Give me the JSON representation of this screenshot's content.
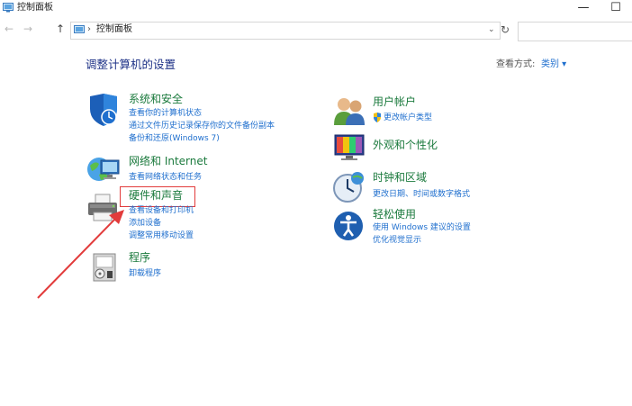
{
  "window": {
    "title": "控制面板",
    "minimize": "—",
    "maximize": "☐"
  },
  "address": {
    "back": "←",
    "forward": "→",
    "up": "↑",
    "separator": "›",
    "path": "控制面板",
    "dropdown": "⌄",
    "refresh": "↻",
    "search_placeholder": ""
  },
  "header": {
    "heading": "调整计算机的设置",
    "view_by_label": "查看方式:",
    "view_by_value": "类别 ▾"
  },
  "categories_left": [
    {
      "title": "系统和安全",
      "links": [
        "查看你的计算机状态",
        "通过文件历史记录保存你的文件备份副本",
        "备份和还原(Windows 7)"
      ]
    },
    {
      "title": "网络和 Internet",
      "links": [
        "查看网络状态和任务"
      ]
    },
    {
      "title": "硬件和声音",
      "links": [
        "查看设备和打印机",
        "添加设备",
        "调整常用移动设置"
      ]
    },
    {
      "title": "程序",
      "links": [
        "卸载程序"
      ]
    }
  ],
  "categories_right": [
    {
      "title": "用户帐户",
      "links": [
        "更改帐户类型"
      ]
    },
    {
      "title": "外观和个性化",
      "links": []
    },
    {
      "title": "时钟和区域",
      "links": [
        "更改日期、时间或数字格式"
      ]
    },
    {
      "title": "轻松使用",
      "links": [
        "使用 Windows 建议的设置",
        "优化视觉显示"
      ]
    }
  ],
  "colors": {
    "heading": "#1e3287",
    "category_title": "#1b7a3d",
    "link": "#1f6fce",
    "annotation": "#e23b3b"
  }
}
